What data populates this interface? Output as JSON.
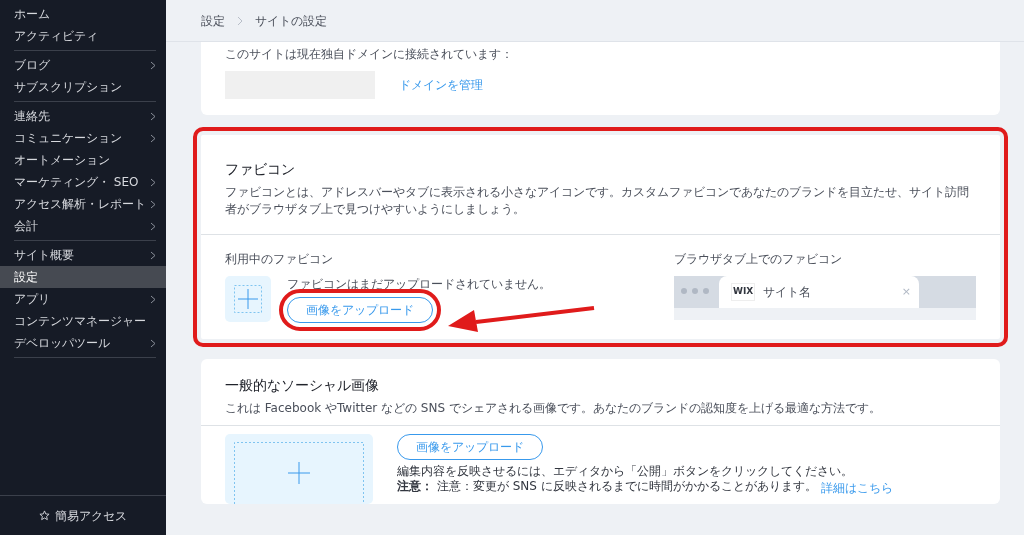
{
  "sidebar": {
    "groups": [
      [
        {
          "label": "ホーム",
          "submenu": false,
          "selected": false
        },
        {
          "label": "アクティビティ",
          "submenu": false,
          "selected": false
        }
      ],
      [
        {
          "label": "ブログ",
          "submenu": true,
          "selected": false
        },
        {
          "label": "サブスクリプション",
          "submenu": false,
          "selected": false
        }
      ],
      [
        {
          "label": "連絡先",
          "submenu": true,
          "selected": false
        },
        {
          "label": "コミュニケーション",
          "submenu": true,
          "selected": false
        },
        {
          "label": "オートメーション",
          "submenu": false,
          "selected": false
        },
        {
          "label": "マーケティング・ SEO",
          "submenu": true,
          "selected": false
        },
        {
          "label": "アクセス解析・レポート",
          "submenu": true,
          "selected": false
        },
        {
          "label": "会計",
          "submenu": true,
          "selected": false
        }
      ],
      [
        {
          "label": "サイト概要",
          "submenu": true,
          "selected": false
        },
        {
          "label": "設定",
          "submenu": false,
          "selected": true
        },
        {
          "label": "アプリ",
          "submenu": true,
          "selected": false
        },
        {
          "label": "コンテンツマネージャー",
          "submenu": false,
          "selected": false
        },
        {
          "label": "デベロッパツール",
          "submenu": true,
          "selected": false
        }
      ]
    ],
    "quick_access": "簡易アクセス"
  },
  "breadcrumb": [
    "設定",
    "サイトの設定"
  ],
  "domain_card": {
    "text": "このサイトは現在独自ドメインに接続されています：",
    "link": "ドメインを管理"
  },
  "favicon_card": {
    "highlighted": true,
    "title": "ファビコン",
    "description": "ファビコンとは、アドレスバーやタブに表示される小さなアイコンです。カスタムファビコンであなたのブランドを目立たせ、サイト訪問者がブラウザタブ上で見つけやすいようにしましょう。",
    "current_label": "利用中のファビコン",
    "status": "ファビコンはまだアップロードされていません。",
    "upload_button": {
      "label": "画像をアップロード",
      "highlighted": true
    },
    "preview_label": "ブラウザタブ上でのファビコン",
    "tab_logo": "WIX",
    "tab_title": "サイト名",
    "tab_close": "×"
  },
  "social_card": {
    "highlighted": false,
    "title": "一般的なソーシャル画像",
    "description": "これは Facebook やTwitter などの SNS でシェアされる画像です。あなたのブランドの認知度を上げる最適な方法です。",
    "upload_button": {
      "label": "画像をアップロード",
      "highlighted": false
    },
    "note": "編集内容を反映させるには、エディタから「公開」ボタンをクリックしてください。",
    "caution": "**注意：** 注意：変更が SNS に反映されるまでに時間がかかることがあります。",
    "more_link": "詳細はこちら"
  }
}
